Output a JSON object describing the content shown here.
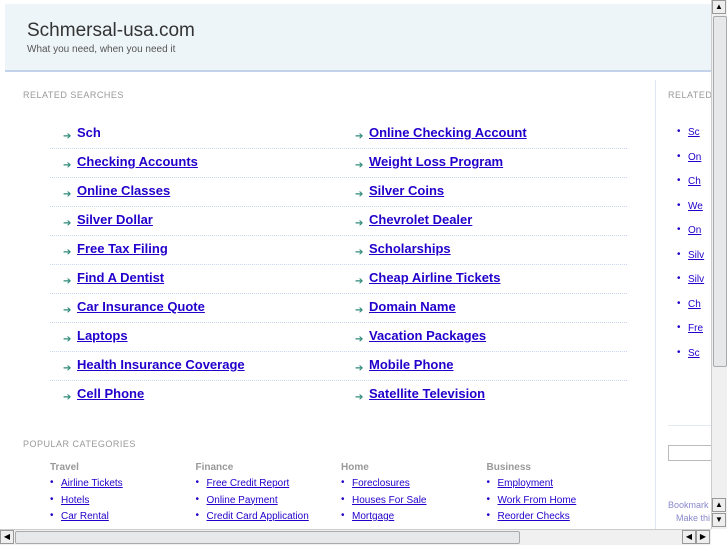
{
  "header": {
    "title": "Schmersal-usa.com",
    "tagline": "What you need, when you need it"
  },
  "related_searches": {
    "label": "RELATED SEARCHES",
    "left": [
      "Sch",
      "Checking Accounts",
      "Online Classes",
      "Silver Dollar",
      "Free Tax Filing",
      "Find A Dentist",
      "Car Insurance Quote",
      "Laptops",
      "Health Insurance Coverage",
      "Cell Phone"
    ],
    "right": [
      "Online Checking Account",
      "Weight Loss Program",
      "Silver Coins",
      "Chevrolet Dealer",
      "Scholarships",
      "Cheap Airline Tickets",
      "Domain Name",
      "Vacation Packages",
      "Mobile Phone",
      "Satellite Television"
    ]
  },
  "popular_categories": {
    "label": "POPULAR CATEGORIES",
    "columns": [
      {
        "title": "Travel",
        "items": [
          "Airline Tickets",
          "Hotels",
          "Car Rental"
        ]
      },
      {
        "title": "Finance",
        "items": [
          "Free Credit Report",
          "Online Payment",
          "Credit Card Application"
        ]
      },
      {
        "title": "Home",
        "items": [
          "Foreclosures",
          "Houses For Sale",
          "Mortgage"
        ]
      },
      {
        "title": "Business",
        "items": [
          "Employment",
          "Work From Home",
          "Reorder Checks"
        ]
      }
    ]
  },
  "sidebar": {
    "label": "RELATED",
    "items": [
      "Sc",
      "On",
      "Ch",
      "We",
      "On",
      "Silv",
      "Silv",
      "Ch",
      "Fre",
      "Sc"
    ],
    "bookmark": "Bookmark",
    "make_this": "Make thi"
  },
  "colors": {
    "link": "#2200cc",
    "header_bg": "#eef5f8",
    "arrow": "#2f8a7a"
  }
}
